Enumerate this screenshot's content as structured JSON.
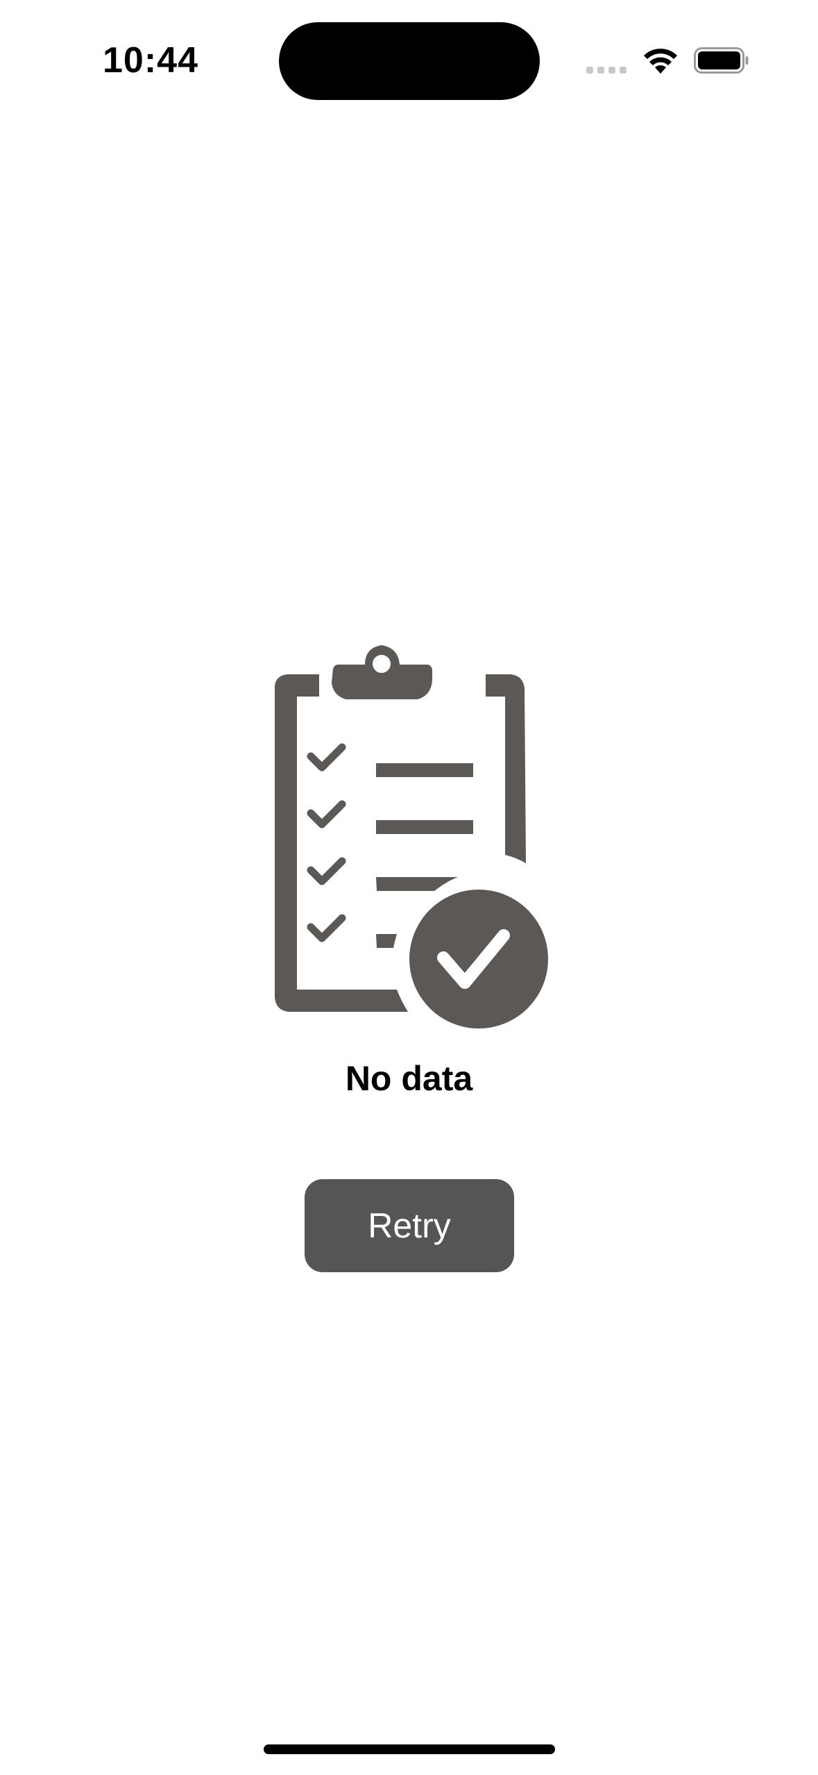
{
  "status_bar": {
    "time": "10:44",
    "icons": [
      "cellular-signal-icon",
      "wifi-icon",
      "battery-icon"
    ]
  },
  "empty_state": {
    "illustration": "clipboard-checklist-icon",
    "title": "No data",
    "retry_label": "Retry"
  },
  "colors": {
    "icon": "#5b5856",
    "button_bg": "#555555",
    "button_text": "#ffffff",
    "text": "#000000"
  }
}
